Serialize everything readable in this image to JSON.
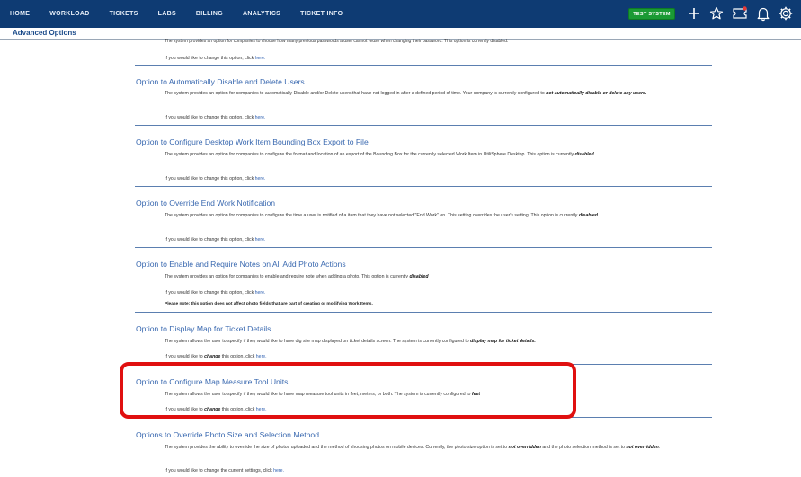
{
  "nav": {
    "items": [
      "HOME",
      "WORKLOAD",
      "TICKETS",
      "LABS",
      "BILLING",
      "ANALYTICS",
      "TICKET INFO"
    ],
    "test_system": "TEST SYSTEM",
    "icons": [
      "plus-icon",
      "star-icon",
      "ticket-icon",
      "bell-icon",
      "gear-icon"
    ],
    "bg_color": "#0e3b73",
    "badge_color": "#1a9a34"
  },
  "subheader": {
    "title": "Advanced Options"
  },
  "intro": {
    "desc": "The system provides an option for companies to choose how many previous passwords a user cannot reuse when changing their password. This option is currently disabled.",
    "link_prefix": "If you would like to change this option, click ",
    "link": "here."
  },
  "sections": [
    {
      "title": "Option to Automatically Disable and Delete Users",
      "desc": "The system provides an option for companies to automatically Disable and/or Delete users that have not logged in after a defined period of time. Your company is currently configured to",
      "desc_bold": "not automatically disable or delete any users.",
      "link_prefix": "If you would like to change this option, click ",
      "link": "here."
    },
    {
      "title": "Option to Configure Desktop Work Item Bounding Box Export to File",
      "desc": "The system provides an option for companies to configure the format and location of an export of the Bounding Box for the currently selected Work Item in UtiliSphere Desktop. This option is currently",
      "desc_bold": "disabled",
      "link_prefix": "If you would like to change this option, click ",
      "link": "here."
    },
    {
      "title": "Option to Override End Work Notification",
      "desc": "The system provides an option for companies to configure the time a user is notified of a item that they have not selected \"End Work\" on. This setting overrides the user's setting. This option is currently",
      "desc_bold": "disabled",
      "link_prefix": "If you would like to change this option, click ",
      "link": "here."
    },
    {
      "title": "Option to Enable and Require Notes on All Add Photo Actions",
      "desc": "The system provides an option for companies to enable and require note when adding a photo. This option is currently",
      "desc_bold": "disabled",
      "link_prefix": "If you would like to change this option, click ",
      "link": "here.",
      "note": "Please note: this option does not affect photo fields that are part of creating or modifying Work Items."
    },
    {
      "title": "Option to Display Map for Ticket Details",
      "desc": "The system allows the user to specify if they would like to have dig site map displayed on ticket details screen. The system is currently configured to",
      "desc_bold": "display map for ticket details.",
      "link_prefix": "If you would like to ",
      "link_bold": "change",
      "link_mid": " this option, click ",
      "link": "here."
    },
    {
      "title": "Option to Configure Map Measure Tool Units",
      "desc": "The system allows the user to specify if they would like to have map measure tool units in feet, meters, or both. The system is currently configured to",
      "desc_bold": "feet",
      "link_prefix": "If you would like to ",
      "link_bold": "change",
      "link_mid": " this option, click ",
      "link": "here."
    },
    {
      "title": "Options to Override Photo Size and Selection Method",
      "desc": "The system provides the ability to override the size of photos uploaded and the method of choosing photos on mobile devices. Currently, the photo size option is set to",
      "desc_bold": "not overridden",
      "desc_mid": " and the photo selection method is set to ",
      "desc_bold2": "not overridden",
      "desc_end": ".",
      "link_prefix": "If you would like to change the current settings, click ",
      "link": "here."
    }
  ]
}
